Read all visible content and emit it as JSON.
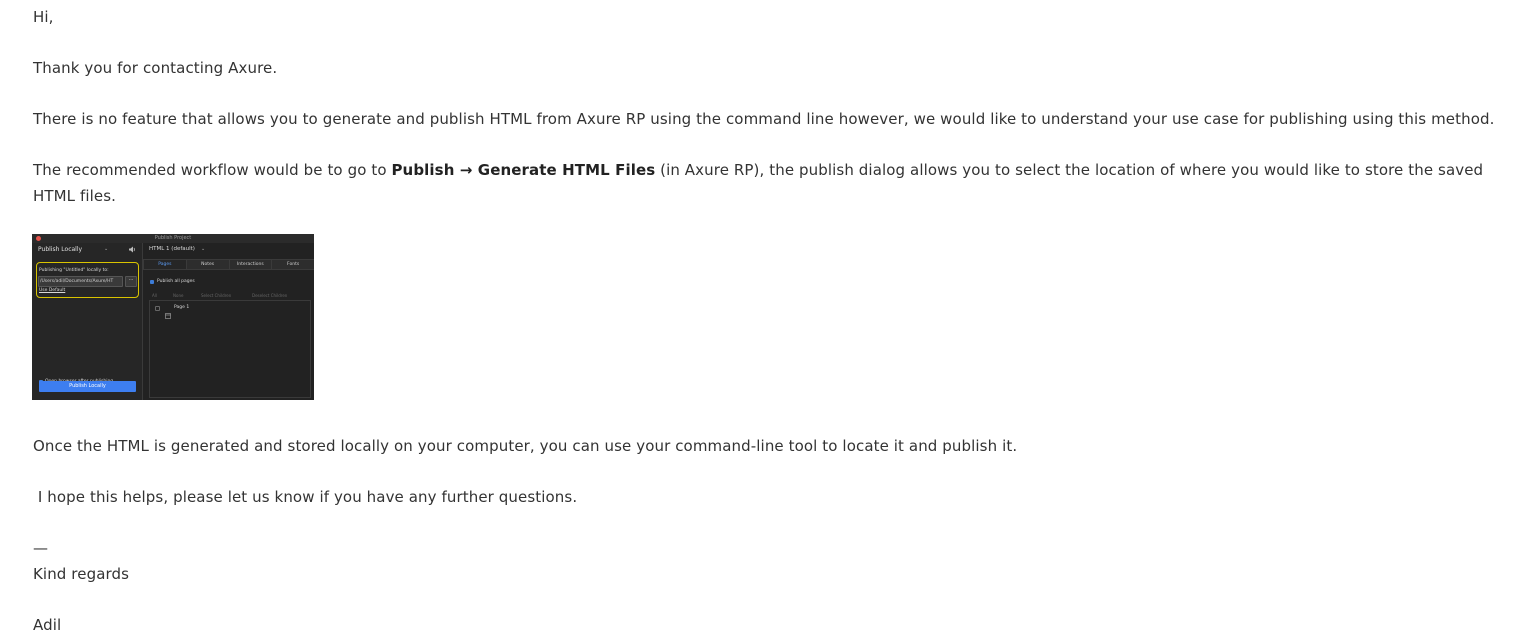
{
  "email": {
    "greeting": "Hi,",
    "thanks": "Thank you for contacting Axure.",
    "no_feature": "There is no feature that allows you to generate and publish HTML from Axure RP using the command line however, we would like to understand your use case for publishing using this method.",
    "workflow_prefix": "The recommended workflow would be to go to ",
    "workflow_publish": "Publish",
    "workflow_arrow": "→",
    "workflow_generate": "Generate HTML Files",
    "workflow_suffix": " (in Axure RP), the publish dialog allows you to select the location of where you would like to store the saved HTML files.",
    "once_generated": "Once the HTML is generated and stored locally on your computer, you can use your command-line tool to locate it and publish it.",
    "hope_helps": " I hope this helps, please let us know if you have any further questions.",
    "dash": "—",
    "kind_regards": "Kind regards",
    "signature": "Adil"
  },
  "dialog_screenshot": {
    "window_title": "Publish Project",
    "mode": "Publish Locally",
    "mode_chevron": "⌄",
    "speaker_icon": "speaker-icon",
    "publishing_label": "Publishing \"Untitled\" locally to:",
    "path_value": "/Users/adil/Documents/Axure/HT",
    "dots": "···",
    "use_default": "Use Default",
    "open_browser": "Open browser after publishing",
    "publish_button": "Publish Locally",
    "html_config": "HTML 1 (default)",
    "config_chevron": "⌄",
    "tabs": [
      "Pages",
      "Notes",
      "Interactions",
      "Fonts"
    ],
    "publish_all_pages": "Publish all pages",
    "filter_all": "All",
    "filter_none": "None",
    "filter_select_children": "Select Children",
    "filter_deselect_children": "Deselect Children",
    "page_item": "Page 1",
    "colors": {
      "highlight": "#d9c400",
      "accent": "#3d7ef0",
      "background": "#1e1e1e"
    }
  }
}
